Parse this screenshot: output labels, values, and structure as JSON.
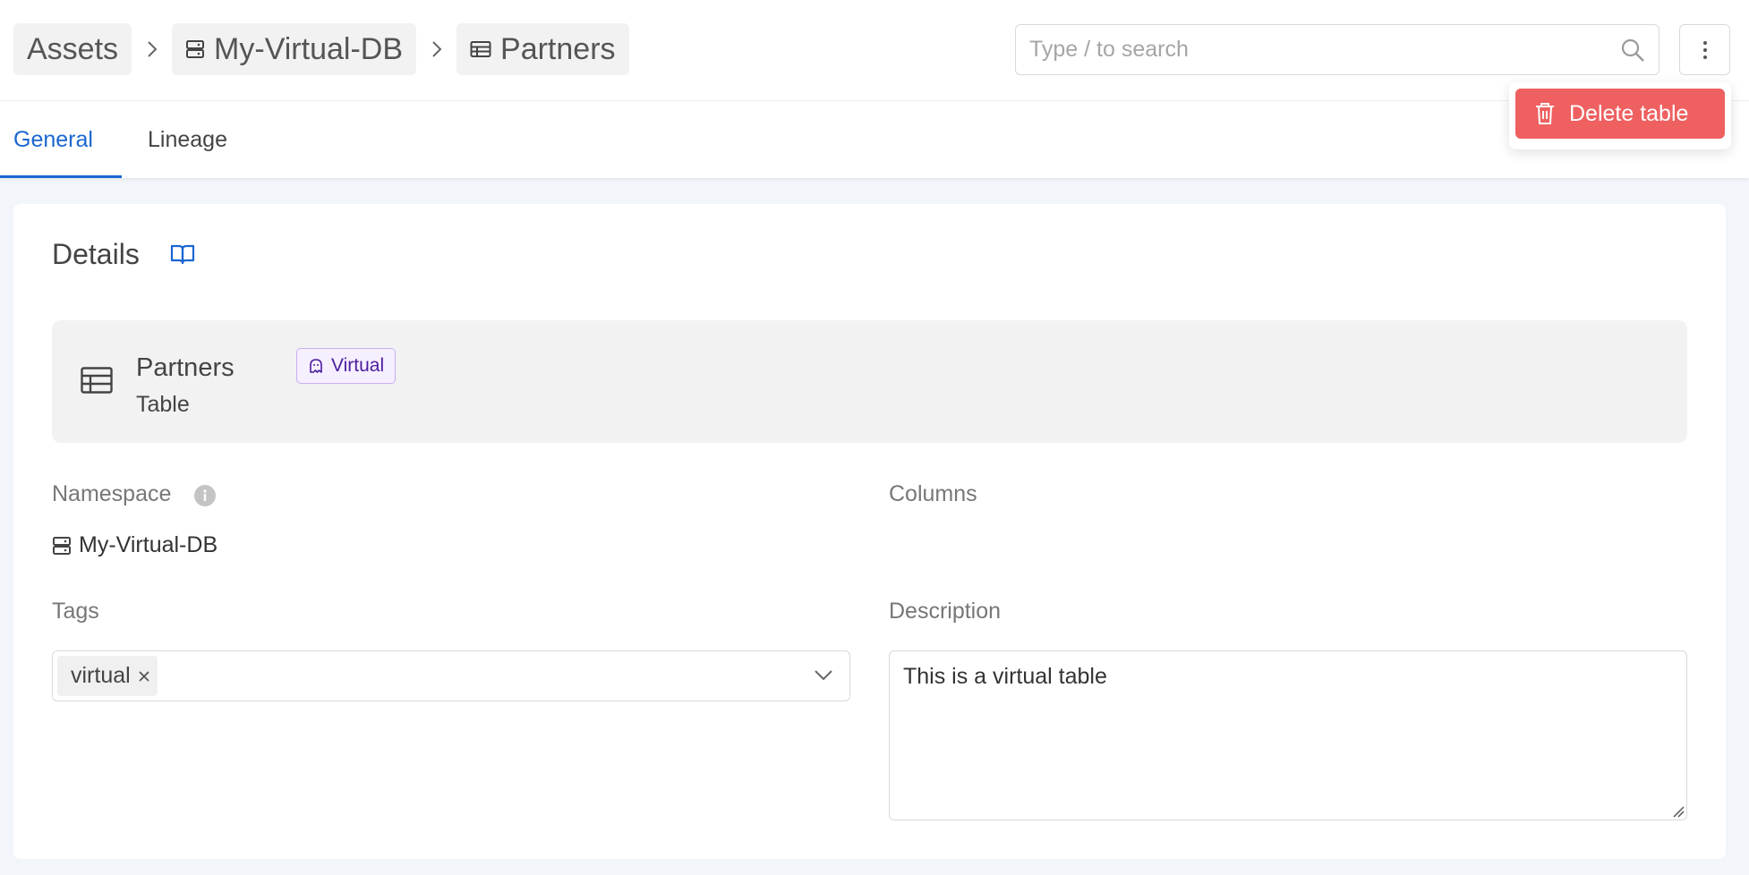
{
  "breadcrumb": {
    "items": [
      {
        "label": "Assets",
        "icon": "none"
      },
      {
        "label": "My-Virtual-DB",
        "icon": "database-icon"
      },
      {
        "label": "Partners",
        "icon": "table-icon"
      }
    ]
  },
  "search": {
    "placeholder": "Type / to search",
    "value": ""
  },
  "menu": {
    "delete_label": "Delete table",
    "icon": "trash-icon"
  },
  "tabs": [
    {
      "label": "General",
      "active": true
    },
    {
      "label": "Lineage",
      "active": false
    }
  ],
  "details": {
    "title": "Details",
    "asset": {
      "name": "Partners",
      "type": "Table",
      "badge": "Virtual"
    },
    "namespace": {
      "label": "Namespace",
      "value": "My-Virtual-DB"
    },
    "columns": {
      "label": "Columns"
    },
    "tags": {
      "label": "Tags",
      "items": [
        "virtual"
      ]
    },
    "description": {
      "label": "Description",
      "value": "This is a virtual table"
    }
  },
  "colors": {
    "accent": "#1a66d1",
    "danger": "#ef6060",
    "badge_bg": "#f6efff",
    "badge_text": "#4b1d9e"
  }
}
